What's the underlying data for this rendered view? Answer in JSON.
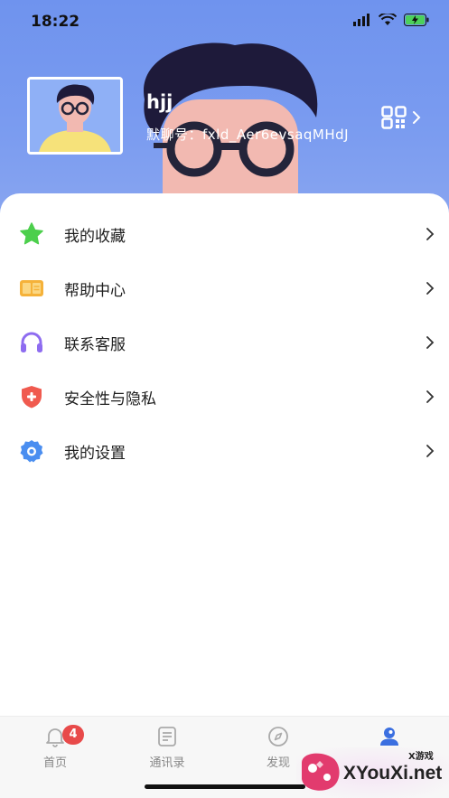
{
  "status_bar": {
    "time": "18:22"
  },
  "profile": {
    "name": "hjj",
    "chat_id": "默聊号：fxld_Aer6evsaqMHdJ"
  },
  "menu": [
    {
      "label": "我的收藏",
      "icon": "star-icon"
    },
    {
      "label": "帮助中心",
      "icon": "book-icon"
    },
    {
      "label": "联系客服",
      "icon": "headset-icon"
    },
    {
      "label": "安全性与隐私",
      "icon": "shield-plus-icon"
    },
    {
      "label": "我的设置",
      "icon": "gear-icon"
    }
  ],
  "tabbar": {
    "tabs": [
      {
        "label": "首页",
        "icon": "bell-icon"
      },
      {
        "label": "通讯录",
        "icon": "contacts-icon"
      },
      {
        "label": "发现",
        "icon": "compass-icon"
      },
      {
        "label": "",
        "icon": "user-icon"
      }
    ],
    "badge": "4"
  },
  "watermark": {
    "text": "XYouXi.net",
    "small": "X游戏"
  },
  "colors": {
    "header": "#7b9cf0",
    "star": "#4ccf4c",
    "book": "#f5b23a",
    "headset": "#8e6cf0",
    "shield": "#f05a4f",
    "gear": "#4a8ef0",
    "badge": "#e84a4a"
  }
}
